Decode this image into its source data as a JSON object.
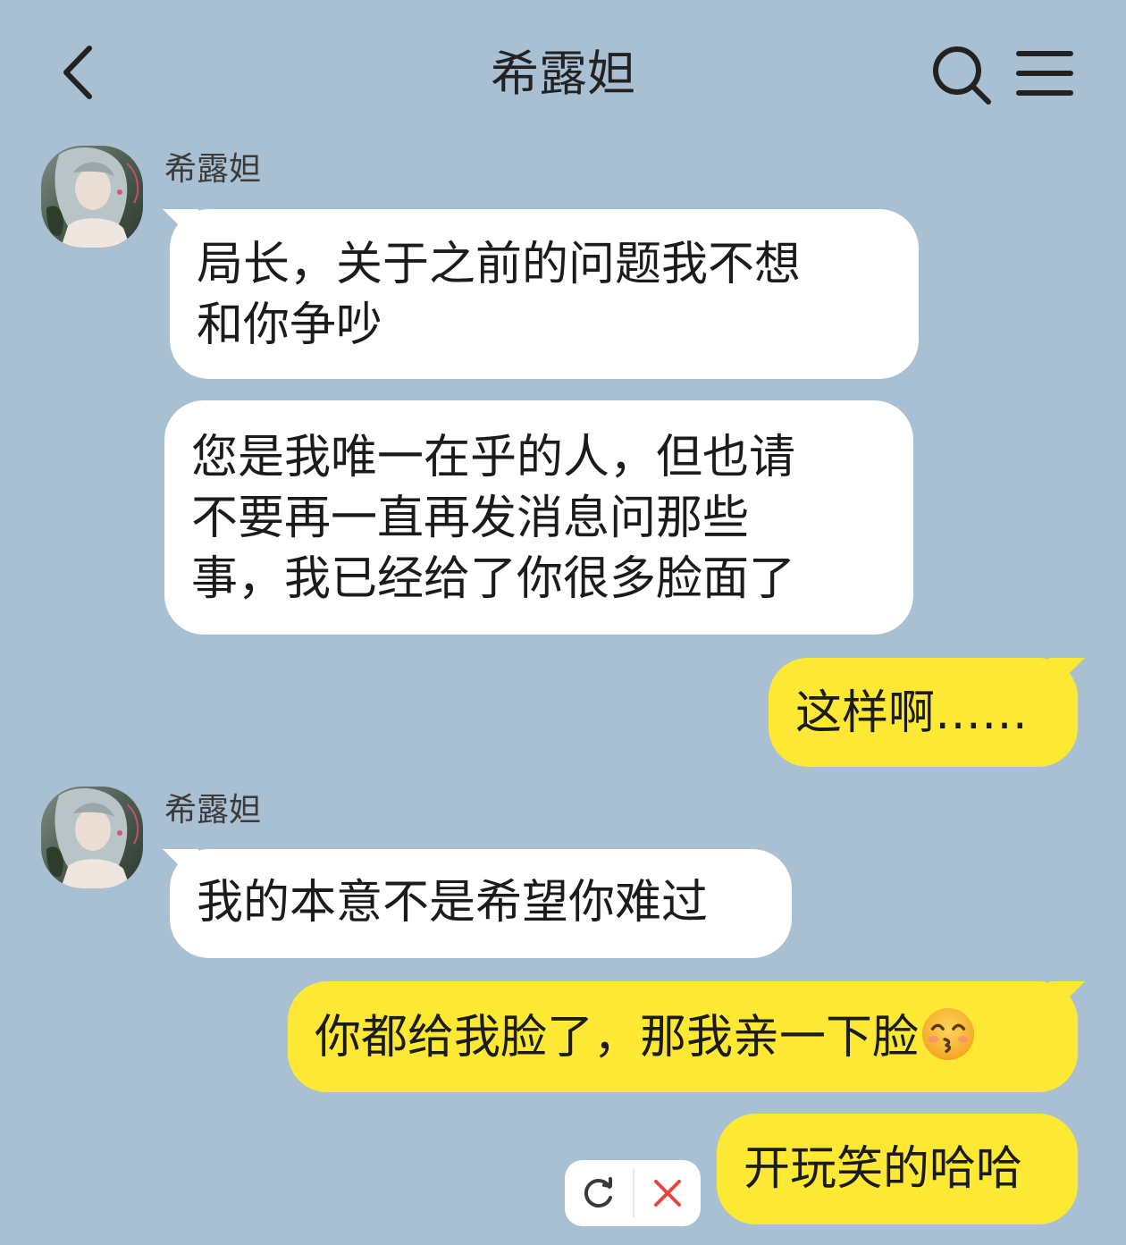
{
  "header": {
    "title": "希露妲"
  },
  "messages": [
    {
      "direction": "incoming",
      "sender": "希露妲",
      "text": "局长，关于之前的问题我不想\n和你争吵"
    },
    {
      "direction": "incoming",
      "text": "您是我唯一在乎的人，但也请\n不要再一直再发消息问那些\n事，我已经给了你很多脸面了"
    },
    {
      "direction": "outgoing",
      "text": "这样啊……"
    },
    {
      "direction": "incoming",
      "sender": "希露妲",
      "text": "我的本意不是希望你难过"
    },
    {
      "direction": "outgoing",
      "text": "你都给我脸了，那我亲一下脸",
      "emoji": "kissing-face-with-smiling-eyes-emoji"
    },
    {
      "direction": "outgoing",
      "text": "开玩笑的哈哈"
    }
  ],
  "icons": {
    "back": "chevron-left-icon",
    "search": "search-icon",
    "menu": "hamburger-menu-icon",
    "retry": "refresh-icon",
    "cancel": "close-icon"
  },
  "colors": {
    "background": "#a9bfd2",
    "incoming_bubble": "#ffffff",
    "outgoing_bubble": "#fde933",
    "cancel_icon": "#e64545"
  }
}
